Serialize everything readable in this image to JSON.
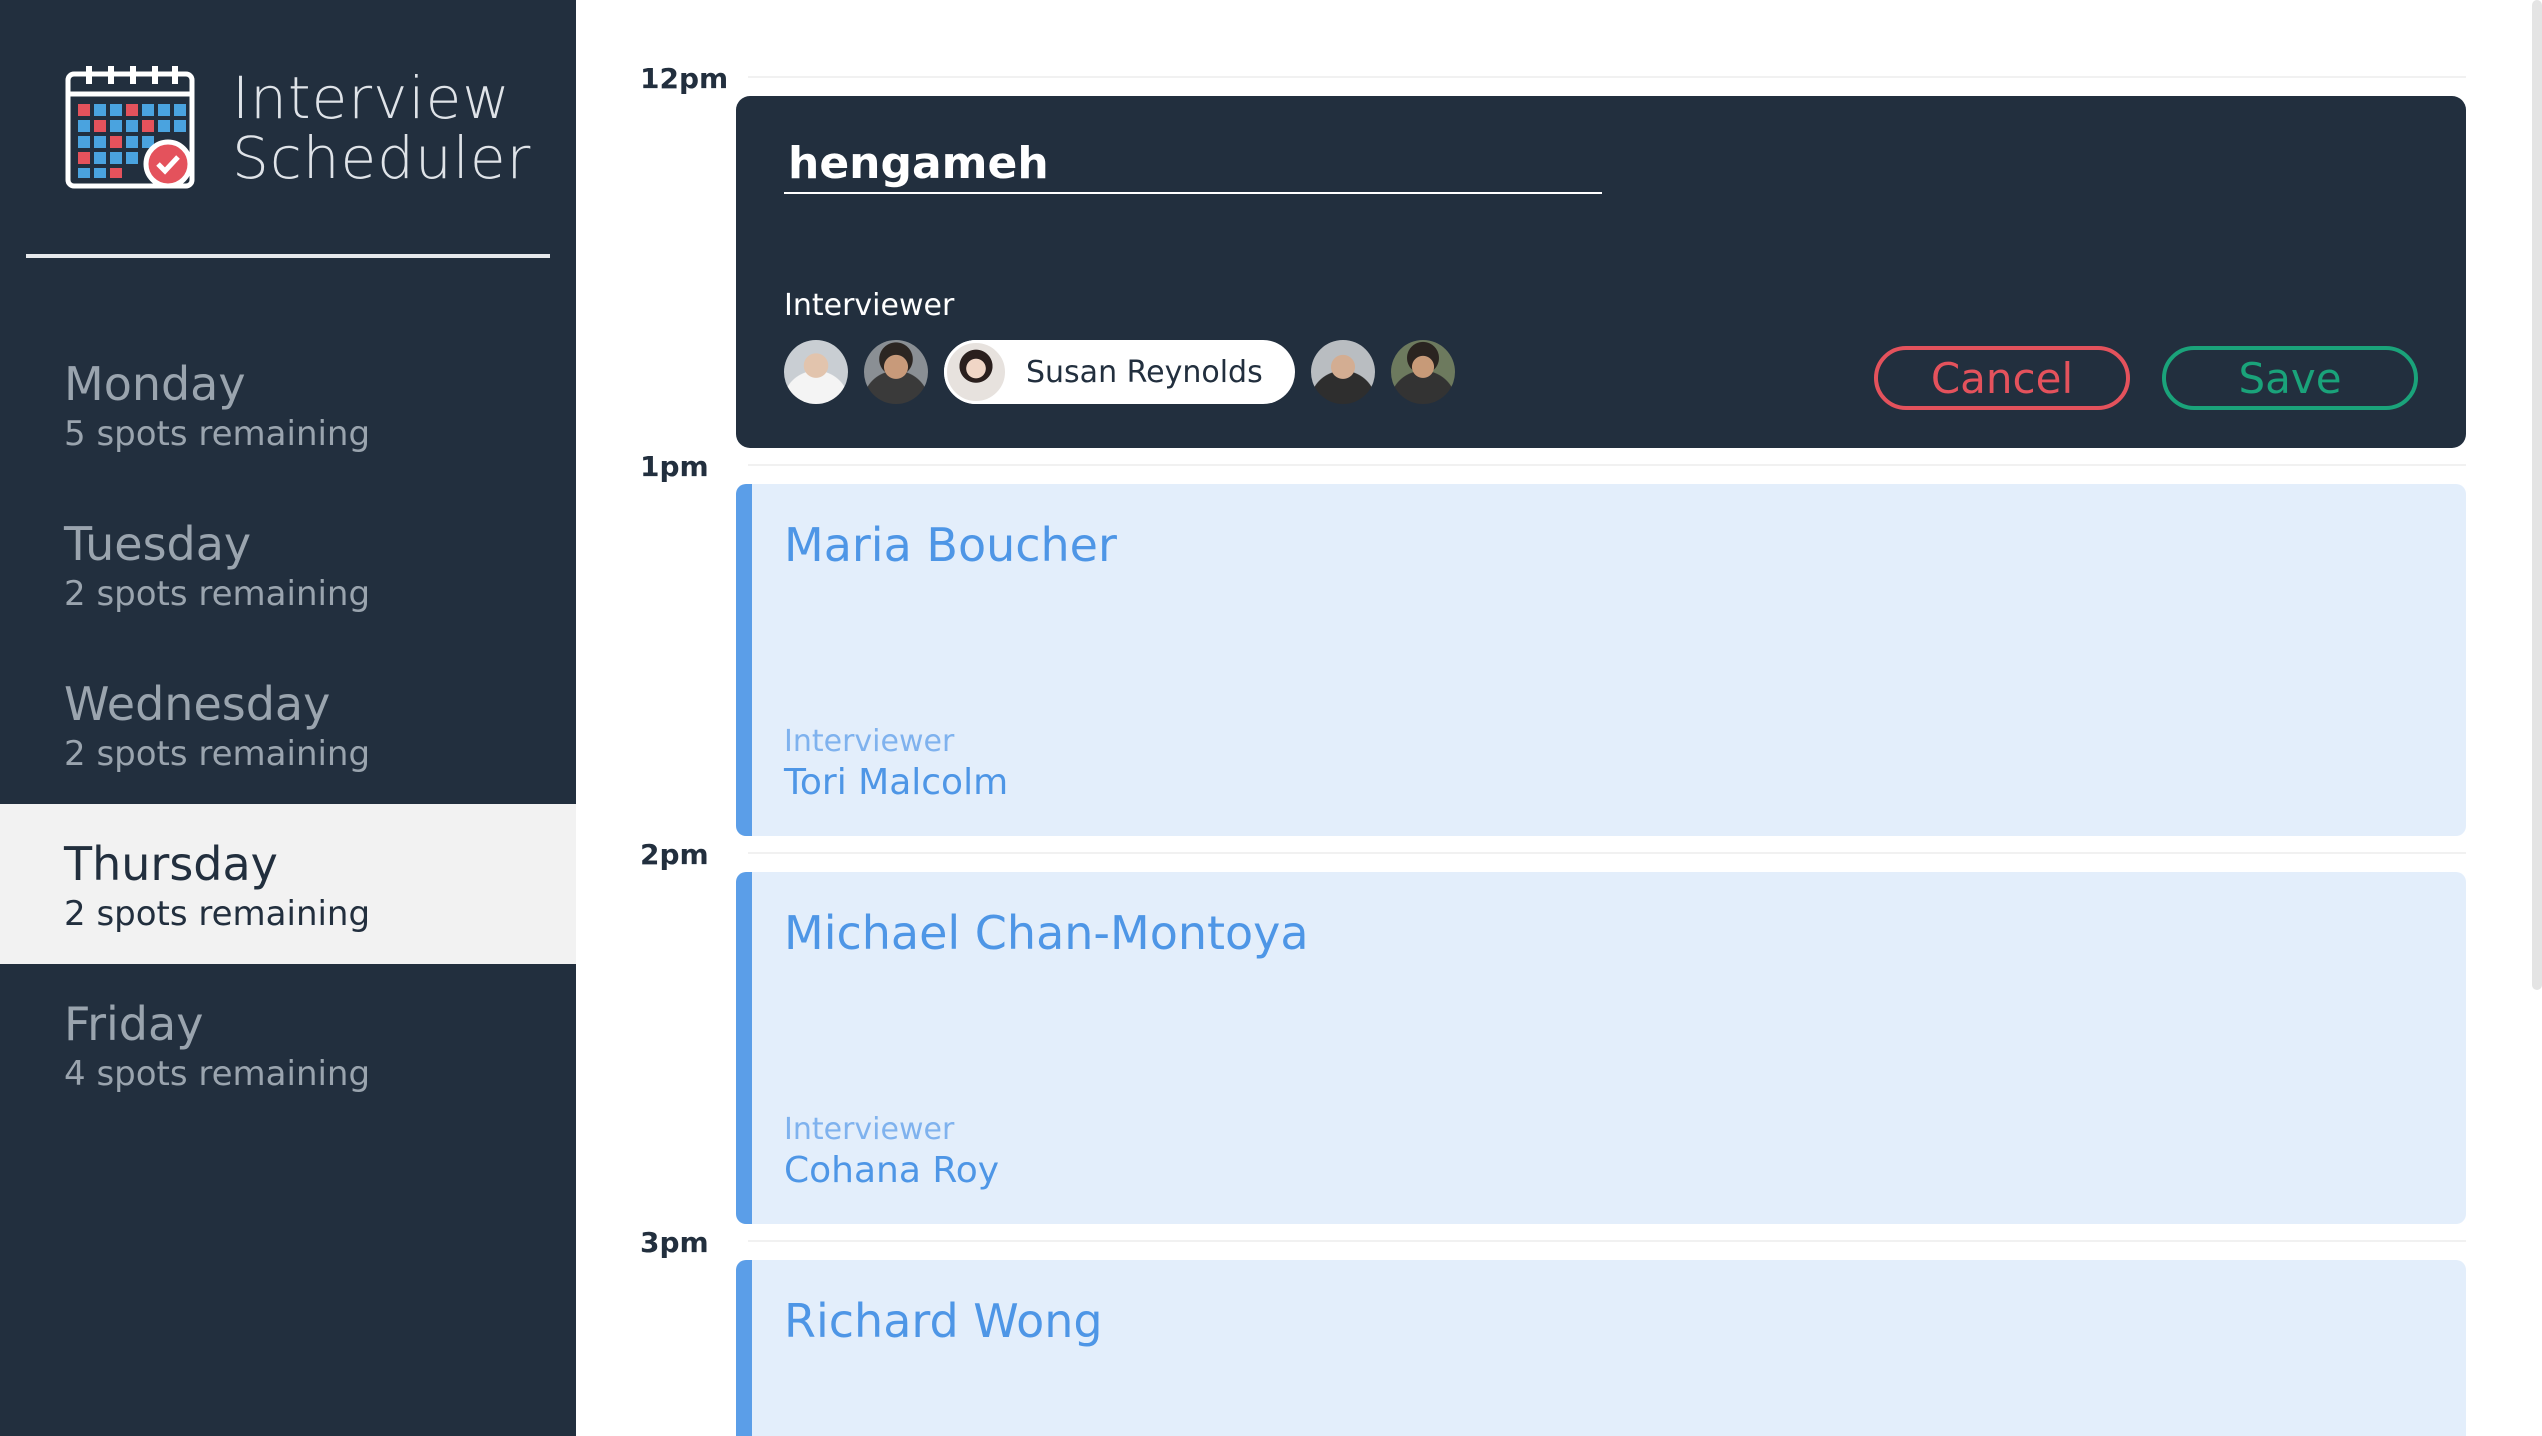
{
  "app": {
    "title_line1": "Interview",
    "title_line2": "Scheduler",
    "logo_icon": "calendar-check-icon"
  },
  "sidebar": {
    "days": [
      {
        "name": "Monday",
        "spots": "5 spots remaining",
        "selected": false
      },
      {
        "name": "Tuesday",
        "spots": "2 spots remaining",
        "selected": false
      },
      {
        "name": "Wednesday",
        "spots": "2 spots remaining",
        "selected": false
      },
      {
        "name": "Thursday",
        "spots": "2 spots remaining",
        "selected": true
      },
      {
        "name": "Friday",
        "spots": "4 spots remaining",
        "selected": false
      }
    ]
  },
  "schedule": {
    "times": [
      "12pm",
      "1pm",
      "2pm",
      "3pm"
    ]
  },
  "form": {
    "student_name": "hengameh",
    "interviewer_label": "Interviewer",
    "interviewers": [
      {
        "name": "",
        "selected": false
      },
      {
        "name": "",
        "selected": false
      },
      {
        "name": "Susan Reynolds",
        "selected": true
      },
      {
        "name": "",
        "selected": false
      },
      {
        "name": "",
        "selected": false
      }
    ],
    "cancel_label": "Cancel",
    "save_label": "Save"
  },
  "appointments": [
    {
      "time": "1pm",
      "student": "Maria Boucher",
      "interviewer_label": "Interviewer",
      "interviewer": "Tori Malcolm"
    },
    {
      "time": "2pm",
      "student": "Michael Chan-Montoya",
      "interviewer_label": "Interviewer",
      "interviewer": "Cohana Roy"
    },
    {
      "time": "3pm",
      "student": "Richard Wong",
      "interviewer_label": "",
      "interviewer": ""
    }
  ],
  "colors": {
    "sidebar_bg": "#222f3e",
    "selected_day_bg": "#f2f2f2",
    "appointment_bg": "#e3eefb",
    "appointment_accent": "#5b9ee8",
    "cancel": "#e4525c",
    "save": "#1aa37a"
  }
}
